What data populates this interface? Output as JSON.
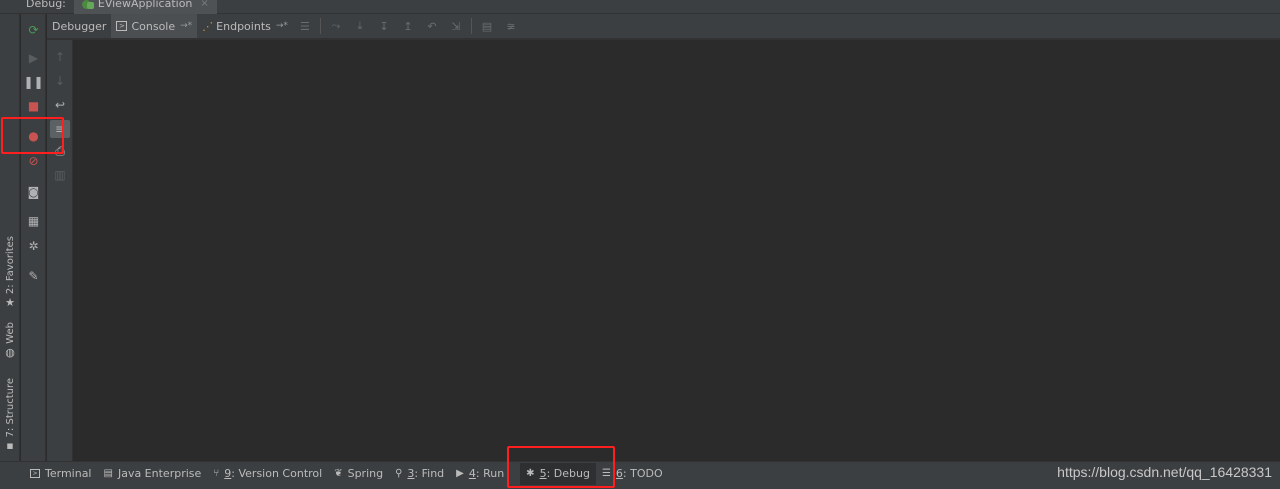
{
  "title_bar": {
    "label": "Debug:",
    "run_tab": {
      "label": "EViewApplication",
      "close": "×"
    }
  },
  "left_stripe": {
    "favorites": {
      "label": "2: Favorites",
      "icon": "★"
    },
    "web": {
      "label": "Web",
      "icon": "◍"
    },
    "structure": {
      "label": "7: Structure",
      "icon": "▪"
    }
  },
  "side_toolbar": {
    "icons": [
      "rerun-icon",
      "resume-icon",
      "pause-icon",
      "stop-icon",
      "view-breakpoints-icon",
      "mute-breakpoints-icon",
      "camera-icon",
      "layout-icon",
      "settings-icon",
      "pin-icon"
    ]
  },
  "tabs": {
    "debugger": "Debugger",
    "console": "Console",
    "endpoints": "Endpoints",
    "pin": "→*"
  },
  "bottom_tools": {
    "terminal": "Terminal",
    "java_enterprise": "Java Enterprise",
    "version_control": {
      "num": "9",
      "rest": ": Version Control"
    },
    "spring": "Spring",
    "find": {
      "num": "3",
      "rest": ": Find"
    },
    "run": {
      "num": "4",
      "rest": ": Run"
    },
    "debug": {
      "num": "5",
      "rest": ": Debug"
    },
    "todo": {
      "num": "6",
      "rest": ": TODO"
    }
  },
  "watermark": "https://blog.csdn.net/qq_16428331",
  "colors": {
    "highlight": "#ff1f1f",
    "panel": "#3c3f41",
    "editor": "#2b2b2b",
    "stop": "#c75450",
    "rerun": "#499c54"
  }
}
